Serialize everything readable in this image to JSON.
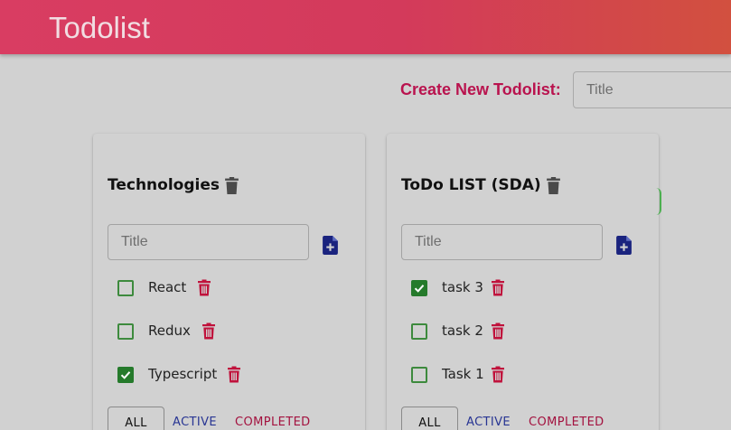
{
  "app": {
    "title": "Todolist"
  },
  "create": {
    "label": "Create New Todolist:",
    "placeholder": "Title"
  },
  "colors": {
    "appbar": "#d83b5e",
    "create_label": "#b9134e",
    "trash_title": "#4a4a4a",
    "trash_task": "#c0123c",
    "add_icon": "#1a237e",
    "checkbox": "#257a2b",
    "active": "#283593",
    "completed": "#a3123f"
  },
  "todolists": [
    {
      "title": "Technologies",
      "input_placeholder": "Title",
      "tasks": [
        {
          "label": "React",
          "done": false
        },
        {
          "label": "Redux",
          "done": false
        },
        {
          "label": "Typescript",
          "done": true
        }
      ],
      "filters": {
        "all": "ALL",
        "active": "ACTIVE",
        "completed": "COMPLETED"
      }
    },
    {
      "title": "ToDo LIST (SDA)",
      "input_placeholder": "Title",
      "tasks": [
        {
          "label": "task 3",
          "done": true
        },
        {
          "label": "task 2",
          "done": false
        },
        {
          "label": "Task 1",
          "done": false
        }
      ],
      "filters": {
        "all": "ALL",
        "active": "ACTIVE",
        "completed": "COMPLETED"
      }
    }
  ],
  "icons": {
    "title_delete": "trash-icon",
    "task_delete": "trash-icon",
    "add_task": "file-plus-icon",
    "check": "check-icon"
  }
}
